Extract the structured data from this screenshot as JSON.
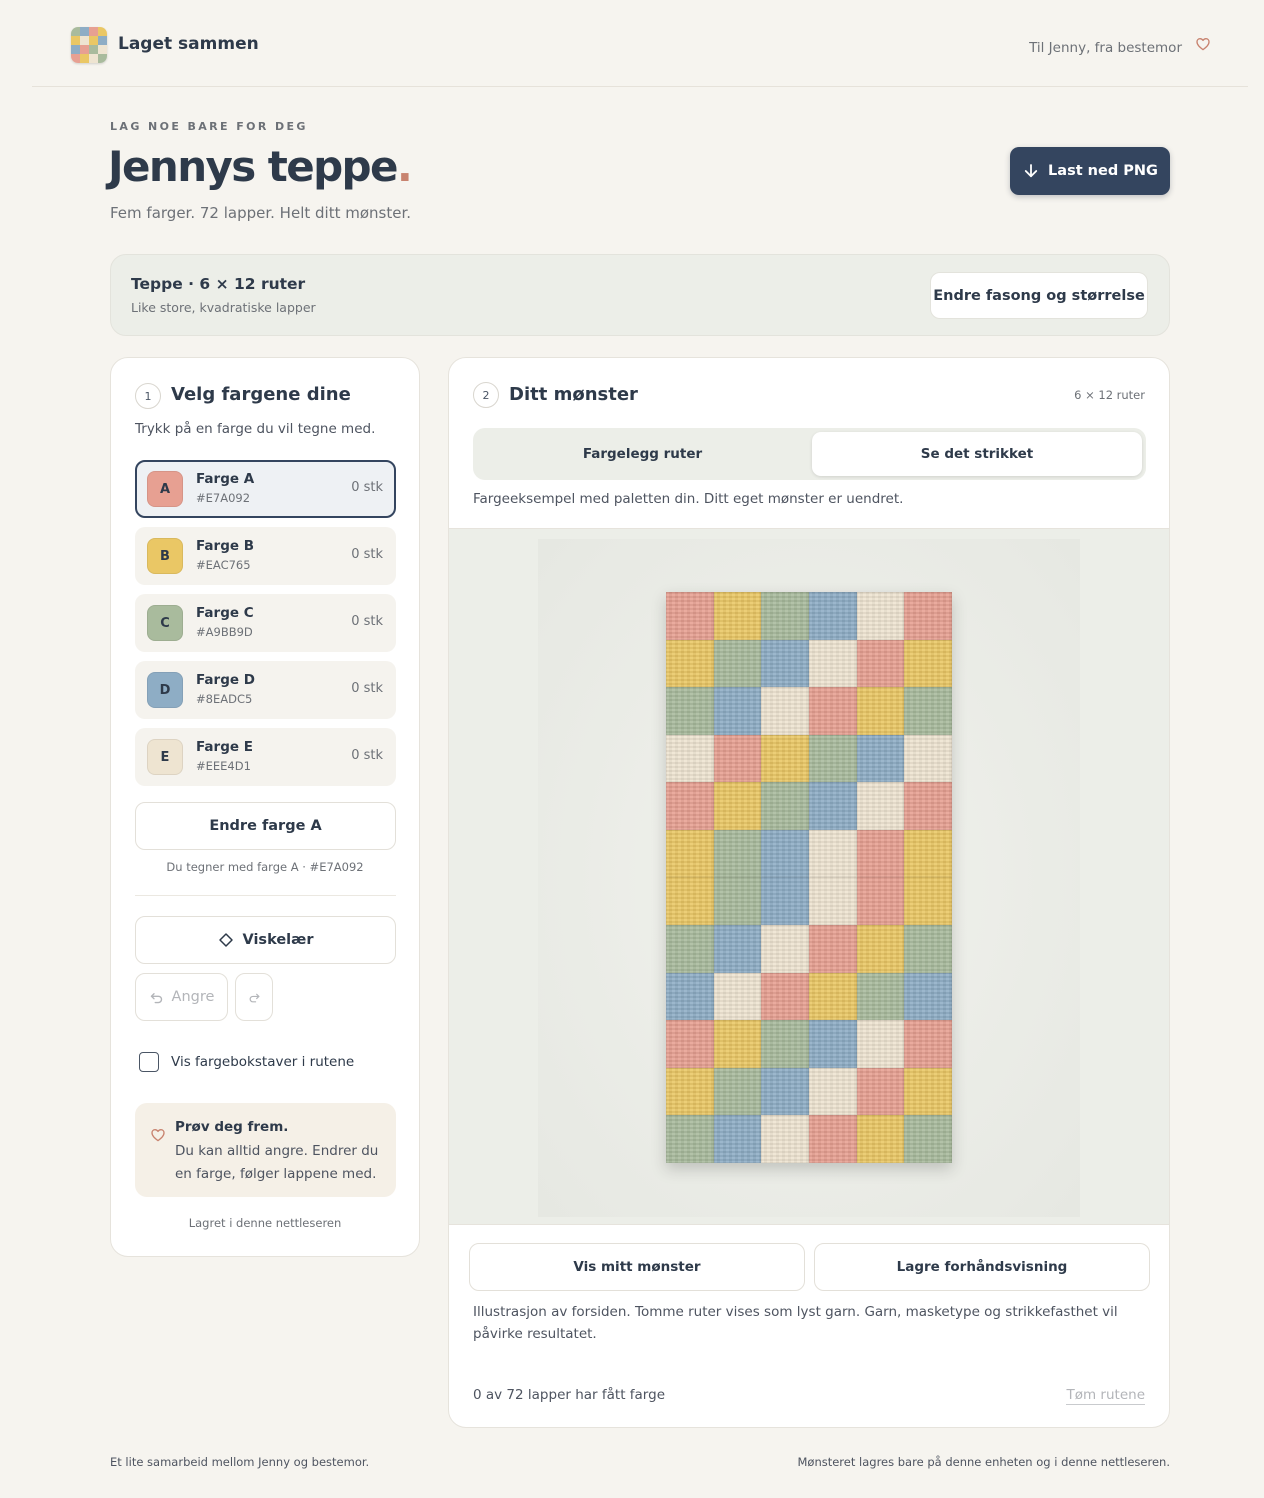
{
  "header": {
    "brand": "Laget sammen",
    "greeting": "Til Jenny, fra bestemor"
  },
  "hero": {
    "eyebrow": "LAG NOE BARE FOR DEG",
    "title": "Jennys teppe",
    "title_dot": ".",
    "subtitle": "Fem farger. 72 lapper. Helt ditt mønster.",
    "download_label": "Last ned PNG"
  },
  "size_bar": {
    "title": "Teppe · 6 × 12 ruter",
    "subtitle": "Like store, kvadratiske lapper",
    "change_label": "Endre fasong og størrelse"
  },
  "palette_panel": {
    "step": "1",
    "heading": "Velg fargene dine",
    "instruction": "Trykk på en farge du vil tegne med.",
    "colors": [
      {
        "letter": "A",
        "name": "Farge A",
        "hex": "#E7A092",
        "count": "0 stk",
        "color": "#E7A092",
        "active": true
      },
      {
        "letter": "B",
        "name": "Farge B",
        "hex": "#EAC765",
        "count": "0 stk",
        "color": "#EAC765",
        "active": false
      },
      {
        "letter": "C",
        "name": "Farge C",
        "hex": "#A9BB9D",
        "count": "0 stk",
        "color": "#A9BB9D",
        "active": false
      },
      {
        "letter": "D",
        "name": "Farge D",
        "hex": "#8EADC5",
        "count": "0 stk",
        "color": "#8EADC5",
        "active": false
      },
      {
        "letter": "E",
        "name": "Farge E",
        "hex": "#EEE4D1",
        "count": "0 stk",
        "color": "#EEE4D1",
        "active": false
      }
    ],
    "change_color_label": "Endre farge A",
    "drawing_with": "Du tegner med farge A · #E7A092",
    "eraser_label": "Viskelær",
    "undo_label": "Angre",
    "show_letters_label": "Vis fargebokstaver i rutene",
    "show_letters_checked": false,
    "tip_title": "Prøv deg frem.",
    "tip_text": "Du kan alltid angre. Endrer du en farge, følger lappene med.",
    "saved_note": "Lagret i denne nettleseren"
  },
  "pattern_panel": {
    "step": "2",
    "heading": "Ditt mønster",
    "grid_size": "6 × 12 ruter",
    "tabs": [
      {
        "label": "Fargelegg ruter",
        "active": false
      },
      {
        "label": "Se det strikket",
        "active": true
      }
    ],
    "example_note": "Fargeeksempel med paletten din. Ditt eget mønster er uendret.",
    "preview_columns": 6,
    "preview_rows": [
      [
        "A",
        "B",
        "C",
        "D",
        "E",
        "A"
      ],
      [
        "B",
        "C",
        "D",
        "E",
        "A",
        "B"
      ],
      [
        "C",
        "D",
        "E",
        "A",
        "B",
        "C"
      ],
      [
        "E",
        "A",
        "B",
        "C",
        "D",
        "E"
      ],
      [
        "A",
        "B",
        "C",
        "D",
        "E",
        "A"
      ],
      [
        "B",
        "C",
        "D",
        "E",
        "A",
        "B"
      ],
      [
        "B",
        "C",
        "D",
        "E",
        "A",
        "B"
      ],
      [
        "C",
        "D",
        "E",
        "A",
        "B",
        "C"
      ],
      [
        "D",
        "E",
        "A",
        "B",
        "C",
        "D"
      ],
      [
        "A",
        "B",
        "C",
        "D",
        "E",
        "A"
      ],
      [
        "B",
        "C",
        "D",
        "E",
        "A",
        "B"
      ],
      [
        "C",
        "D",
        "E",
        "A",
        "B",
        "C"
      ]
    ],
    "show_pattern_label": "Vis mitt mønster",
    "save_preview_label": "Lagre forhåndsvisning",
    "illustration_note": "Illustrasjon av forsiden. Tomme ruter vises som lyst garn. Garn, masketype og strikkefasthet vil påvirke resultatet.",
    "progress": "0 av 72 lapper har fått farge",
    "clear_label": "Tøm rutene"
  },
  "footer": {
    "left": "Et lite samarbeid mellom Jenny og bestemor.",
    "right": "Mønsteret lagres bare på denne enheten og i denne nettleseren."
  },
  "colors": {
    "accent": "#34455F",
    "background": "#F6F4EF",
    "heart": "#C8836F"
  }
}
